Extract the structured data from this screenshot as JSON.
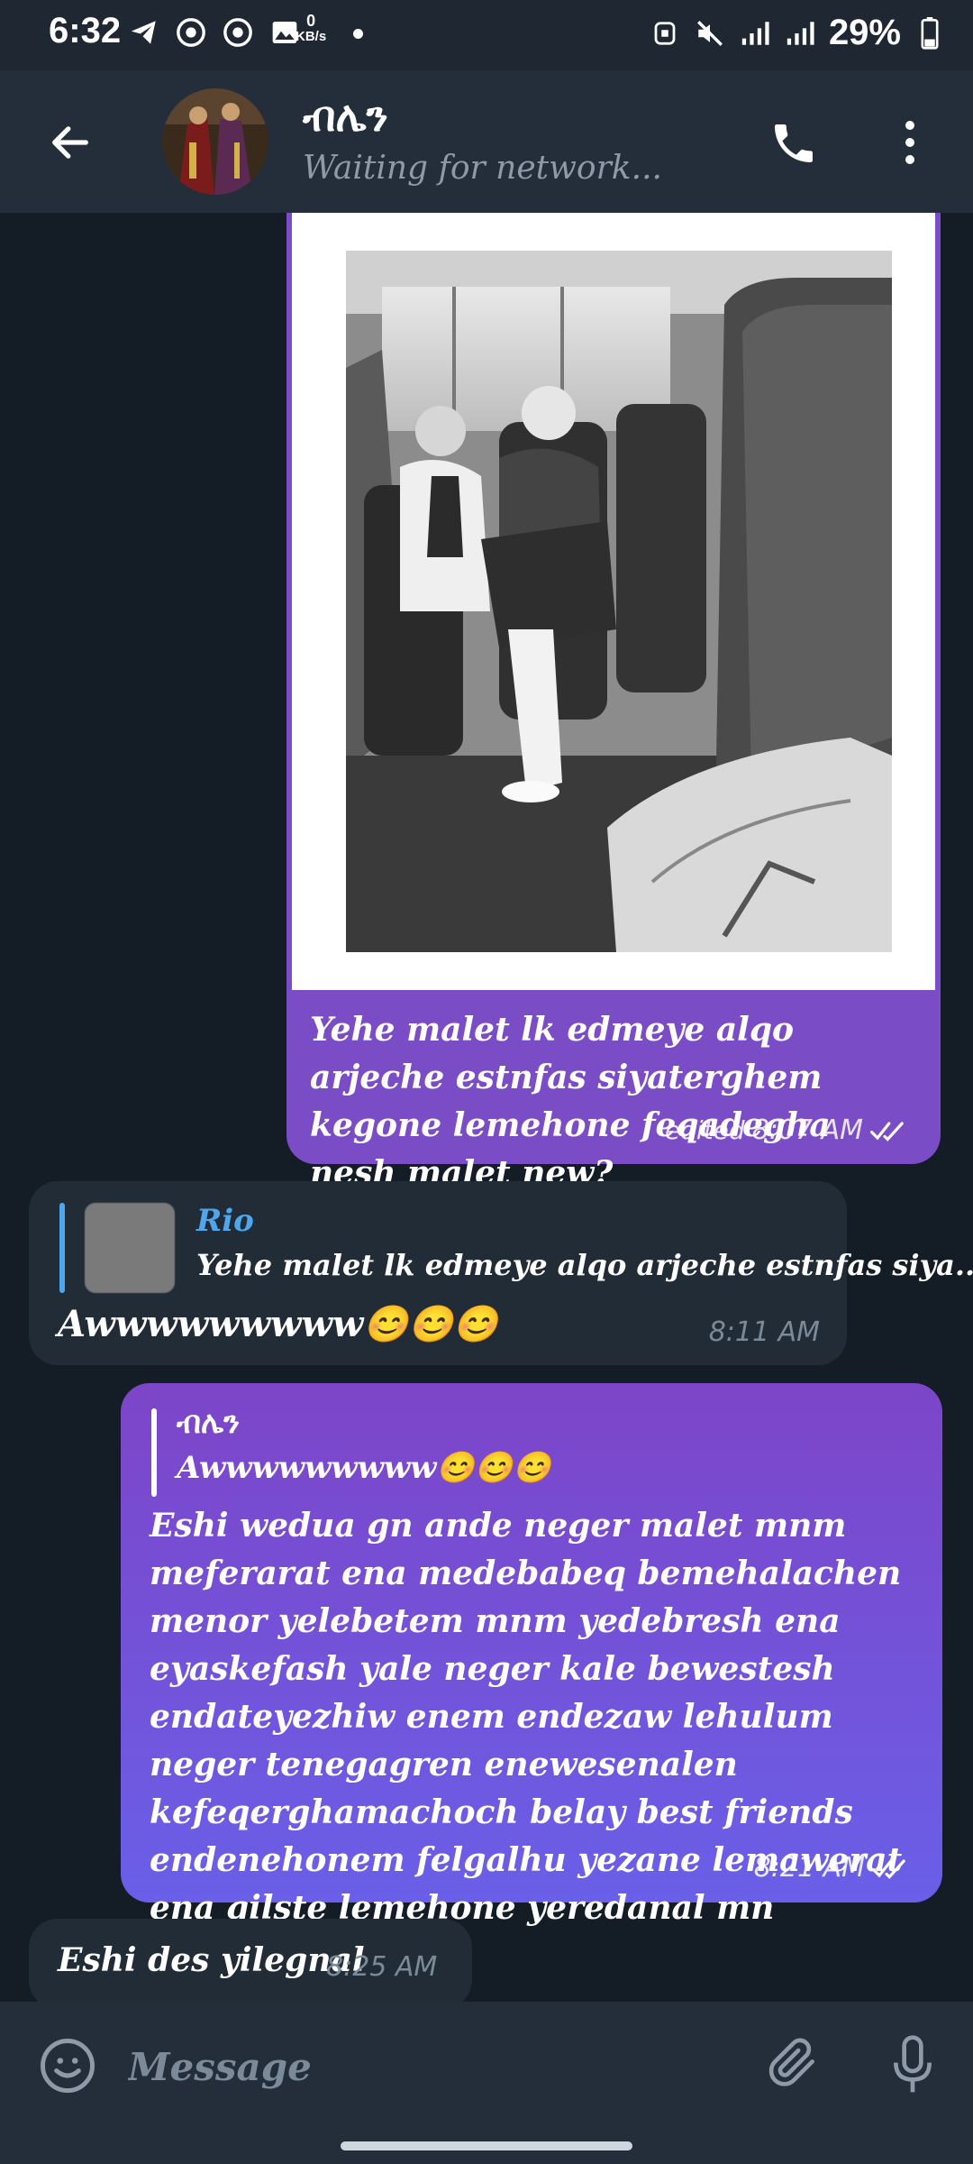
{
  "status_bar": {
    "time": "6:32",
    "net_speed_value": "0",
    "net_speed_unit": "KB/s",
    "battery": "29%"
  },
  "header": {
    "contact_name": "ብሌን",
    "status": "Waiting for network..."
  },
  "messages": [
    {
      "direction": "outgoing",
      "has_photo": true,
      "text": "Yehe malet lk edmeye alqo arjeche estnfas siyaterghem kegone lemehone feqadegha nesh malet new?",
      "edited_label": "edited",
      "time": "8:07 AM",
      "read": true
    },
    {
      "direction": "incoming",
      "reply_to": {
        "name": "Rio",
        "text": "Yehe malet lk edmeye alqo arjeche estnfas siya..."
      },
      "text": "Awwwwwwwww😊😊😊",
      "time": "8:11 AM"
    },
    {
      "direction": "outgoing",
      "reply_to": {
        "name": "ብሌን",
        "text": "Awwwwwwwww😊😊😊"
      },
      "text": "Eshi wedua gn ande neger malet mnm meferarat ena medebabeq bemehalachen menor yelebetem mnm yedebresh ena eyaskefash yale neger kale bewestesh endateyezhiw enem endezaw lehulum neger tenegagren enewesenalen kefeqerghamachoch belay best friends endenehonem felgalhu yezane lemawerat ena gilste lemehone yeredanal mn teyialesh",
      "time": "8:21 AM",
      "read": true
    },
    {
      "direction": "incoming",
      "text": "Eshi des yilegnal",
      "time": "8:25 AM"
    }
  ],
  "composer": {
    "placeholder": "Message"
  },
  "colors": {
    "background": "#141c26",
    "header": "#232e3a",
    "outgoing_bubble": "#7a4cc6",
    "incoming_bubble": "#222c37",
    "reply_accent": "#4ea6ec"
  },
  "icons": [
    "telegram-icon",
    "chrome-icon",
    "gallery-icon",
    "alarm-icon",
    "mute-icon",
    "signal-icon",
    "battery-icon",
    "back-arrow-icon",
    "phone-icon",
    "more-vert-icon",
    "emoji-icon",
    "attach-icon",
    "mic-icon",
    "double-check-icon"
  ]
}
